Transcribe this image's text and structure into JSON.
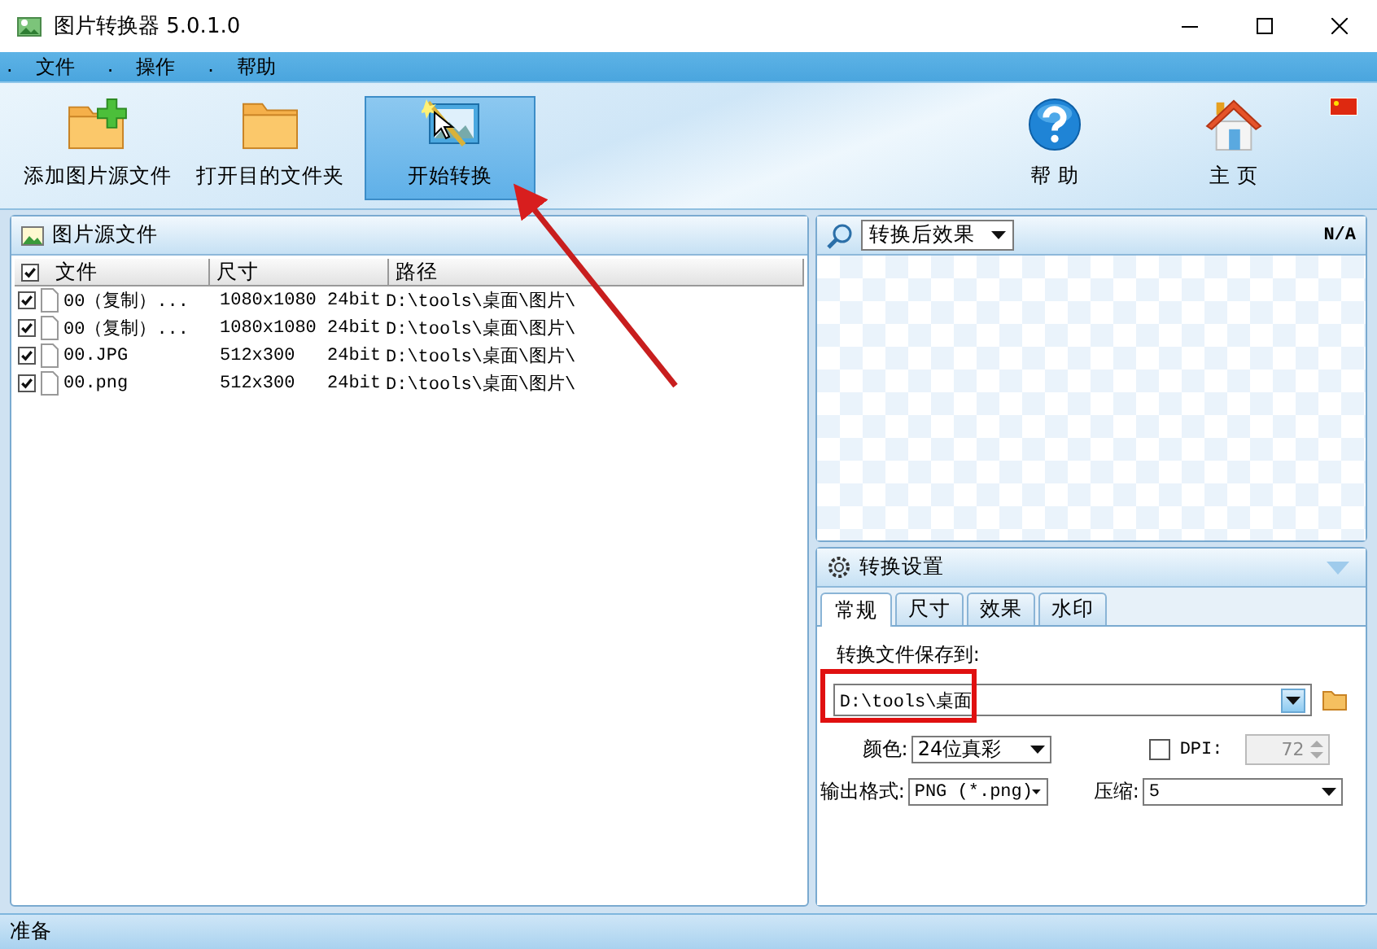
{
  "window": {
    "title": "图片转换器 5.0.1.0"
  },
  "menu": [
    {
      "bullet": ".",
      "label": "文件"
    },
    {
      "bullet": ".",
      "label": "操作"
    },
    {
      "bullet": ".",
      "label": "帮助"
    }
  ],
  "toolbar": [
    {
      "label": "添加图片源文件",
      "kind": "add-folder",
      "selected": false
    },
    {
      "label": "打开目的文件夹",
      "kind": "open-folder",
      "selected": false
    },
    {
      "label": "开始转换",
      "kind": "convert",
      "selected": true
    },
    {
      "label": "帮 助",
      "kind": "help",
      "selected": false
    },
    {
      "label": "主 页",
      "kind": "home",
      "selected": false
    }
  ],
  "source_panel": {
    "title": "图片源文件",
    "select_all": true,
    "columns": [
      "文件",
      "尺寸",
      "路径"
    ],
    "rows": [
      {
        "checked": true,
        "name": "00（复制）...",
        "size": "1080x1080",
        "depth": "24bit",
        "path": "D:\\tools\\桌面\\图片\\"
      },
      {
        "checked": true,
        "name": "00（复制）...",
        "size": "1080x1080",
        "depth": "24bit",
        "path": "D:\\tools\\桌面\\图片\\"
      },
      {
        "checked": true,
        "name": "00.JPG",
        "size": "512x300",
        "depth": "24bit",
        "path": "D:\\tools\\桌面\\图片\\"
      },
      {
        "checked": true,
        "name": "00.png",
        "size": "512x300",
        "depth": "24bit",
        "path": "D:\\tools\\桌面\\图片\\"
      }
    ]
  },
  "preview": {
    "view": "转换后效果",
    "info": "N/A"
  },
  "settings": {
    "title": "转换设置",
    "tabs": [
      {
        "label": "常规",
        "selected": true
      },
      {
        "label": "尺寸",
        "selected": false
      },
      {
        "label": "效果",
        "selected": false
      },
      {
        "label": "水印",
        "selected": false
      }
    ],
    "save_label": "转换文件保存到:",
    "save_path": "D:\\tools\\桌面",
    "color_label": "颜色:",
    "color_depth": "24位真彩",
    "dpi_checked": false,
    "dpi_label": "DPI:",
    "dpi": "72",
    "dpi_disabled": true,
    "format_label": "输出格式:",
    "format": "PNG (*.png)",
    "compress_label": "压缩:",
    "compress": "5"
  },
  "status_bar": "准备"
}
